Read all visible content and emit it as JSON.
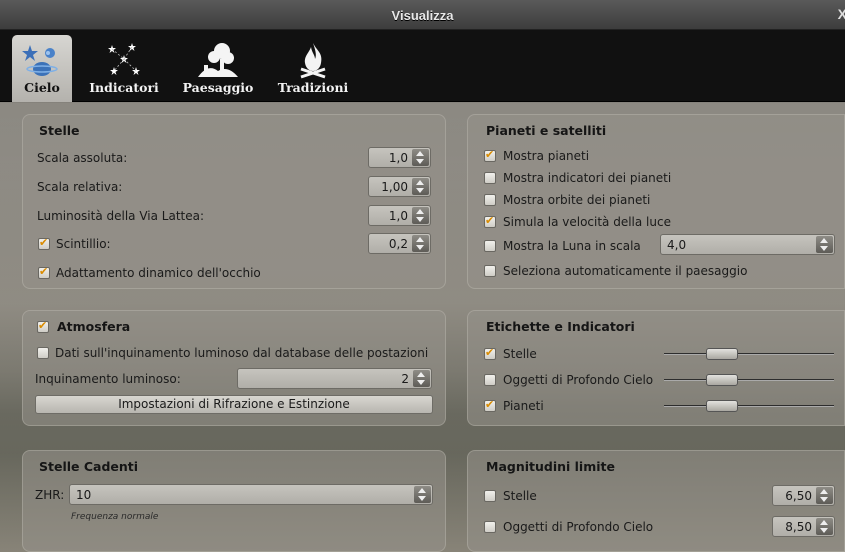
{
  "window": {
    "title": "Visualizza",
    "close_label": "X"
  },
  "tabs": [
    {
      "label": "Cielo",
      "icon": "sky-icon",
      "active": true
    },
    {
      "label": "Indicatori",
      "icon": "markings-icon",
      "active": false
    },
    {
      "label": "Paesaggio",
      "icon": "landscape-icon",
      "active": false
    },
    {
      "label": "Tradizioni",
      "icon": "traditions-icon",
      "active": false
    }
  ],
  "stars": {
    "title": "Stelle",
    "absolute_scale": {
      "label": "Scala assoluta:",
      "value": "1,0"
    },
    "relative_scale": {
      "label": "Scala relativa:",
      "value": "1,00"
    },
    "milky_way": {
      "label": "Luminosità della Via Lattea:",
      "value": "1,0"
    },
    "twinkle": {
      "label": "Scintillio:",
      "value": "0,2",
      "checked": true
    },
    "adaptation": {
      "label": "Adattamento dinamico dell'occhio",
      "checked": true
    }
  },
  "planets": {
    "title": "Pianeti e satelliti",
    "show_planets": {
      "label": "Mostra pianeti",
      "checked": true
    },
    "show_markers": {
      "label": "Mostra indicatori dei pianeti",
      "checked": false
    },
    "show_orbits": {
      "label": "Mostra orbite dei pianeti",
      "checked": false
    },
    "light_speed": {
      "label": "Simula la velocità della luce",
      "checked": true
    },
    "moon_scale": {
      "label": "Mostra la Luna in scala",
      "checked": false,
      "value": "4,0"
    },
    "auto_landscape": {
      "label": "Seleziona automaticamente il paesaggio",
      "checked": false
    }
  },
  "atmosphere": {
    "title": "Atmosfera",
    "checked": true,
    "light_pollution_db": {
      "label": "Dati sull'inquinamento luminoso dal database delle postazioni",
      "checked": false
    },
    "light_pollution": {
      "label": "Inquinamento luminoso:",
      "value": "2"
    },
    "refraction_button": "Impostazioni di Rifrazione e Estinzione"
  },
  "labels": {
    "title": "Etichette e Indicatori",
    "stars": {
      "label": "Stelle",
      "checked": true,
      "level": 0.37
    },
    "dso": {
      "label": "Oggetti di Profondo Cielo",
      "checked": false,
      "level": 0.37
    },
    "planets": {
      "label": "Pianeti",
      "checked": true,
      "level": 0.37
    }
  },
  "shooting_stars": {
    "title": "Stelle Cadenti",
    "zhr_label": "ZHR:",
    "zhr_value": "10",
    "hint": "Frequenza normale"
  },
  "magnitude": {
    "title": "Magnitudini limite",
    "stars": {
      "label": "Stelle",
      "checked": false,
      "value": "6,50"
    },
    "dso": {
      "label": "Oggetti di Profondo Cielo",
      "checked": false,
      "value": "8,50"
    }
  },
  "colors": {
    "check_accent": "#d98b00",
    "tab_bar": "#111111",
    "title_bar": "#4a4a4a"
  }
}
